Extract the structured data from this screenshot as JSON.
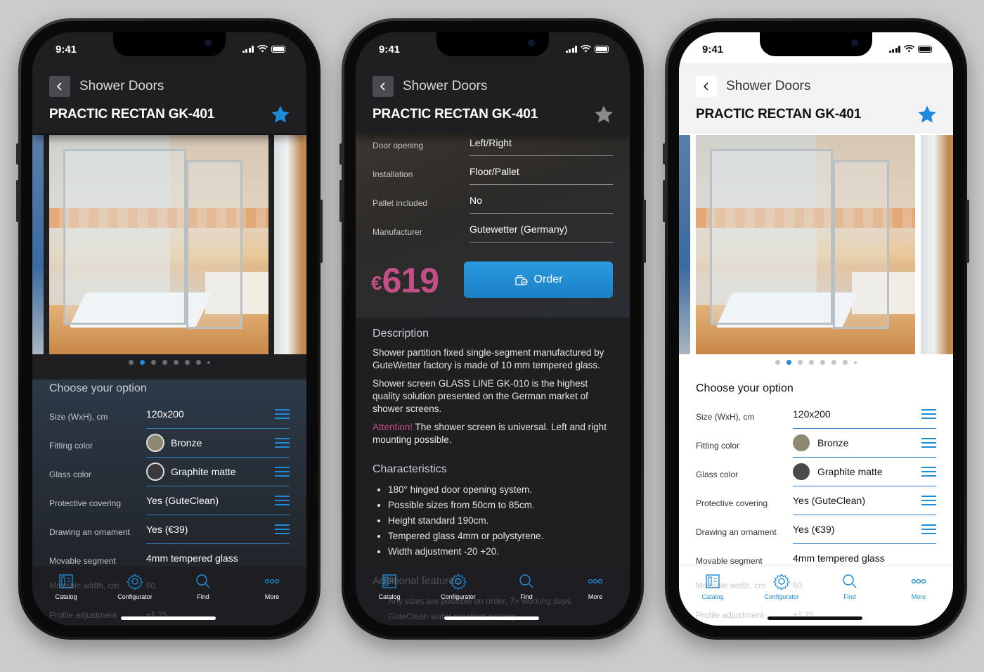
{
  "status": {
    "time": "9:41"
  },
  "header": {
    "crumb": "Shower Doors",
    "title": "PRACTIC RECTAN GK-401"
  },
  "options": {
    "title": "Choose your option",
    "rows": [
      {
        "label": "Size (WxH), cm",
        "value": "120x200"
      },
      {
        "label": "Fitting color",
        "value": "Bronze",
        "swatch": "#8e8a72"
      },
      {
        "label": "Glass color",
        "value": "Graphite matte",
        "swatch": "#4a4a4e"
      },
      {
        "label": "Protective covering",
        "value": "Yes (GuteClean)"
      },
      {
        "label": "Drawing an ornament",
        "value": "Yes (€39)"
      },
      {
        "label": "Movable segment",
        "value": "4mm tempered glass"
      }
    ],
    "faded_rows": [
      {
        "label": "Movable width, cm",
        "value": "60"
      },
      {
        "label": "Profile adjustment",
        "value": "±1.75"
      }
    ]
  },
  "specs": [
    {
      "label": "Door opening",
      "value": "Left/Right"
    },
    {
      "label": "Installation",
      "value": "Floor/Pallet"
    },
    {
      "label": "Pallet included",
      "value": "No"
    },
    {
      "label": "Manufacturer",
      "value": "Gutewetter (Germany)"
    }
  ],
  "price": {
    "currency": "€",
    "amount": "619"
  },
  "order_label": "Order",
  "description": {
    "title": "Description",
    "p1": "Shower partition fixed single-segment manufactured by GuteWetter factory is made of 10 mm tempered glass.",
    "p2": "Shower screen GLASS LINE GK-010 is the highest quality solution presented on the German market of shower screens.",
    "attention": "Attention!",
    "p3": " The shower screen is universal. Left and right mounting possible."
  },
  "characteristics": {
    "title": "Characteristics",
    "items": [
      "180° hinged door opening system.",
      "Possible sizes from 50cm to 85cm.",
      "Height standard 190cm.",
      "Tempered glass 4mm or polystyrene.",
      "Width adjustment -20 +20."
    ],
    "faded": [
      "Additional features",
      "Any sizes are possible on order, 7+ working days",
      "GuteClean water repellent coating"
    ]
  },
  "tabs": [
    {
      "label": "Catalog",
      "icon": "catalog-icon"
    },
    {
      "label": "Configurator",
      "icon": "gear-icon"
    },
    {
      "label": "Find",
      "icon": "search-icon"
    },
    {
      "label": "More",
      "icon": "more-icon"
    }
  ],
  "colors": {
    "accent": "#1e8ad8",
    "price": "#c24f86",
    "star_active": "#1e8ad8",
    "star_inactive": "#8a8a8a"
  },
  "gallery": {
    "active_dot": 1,
    "dot_count": 8
  }
}
